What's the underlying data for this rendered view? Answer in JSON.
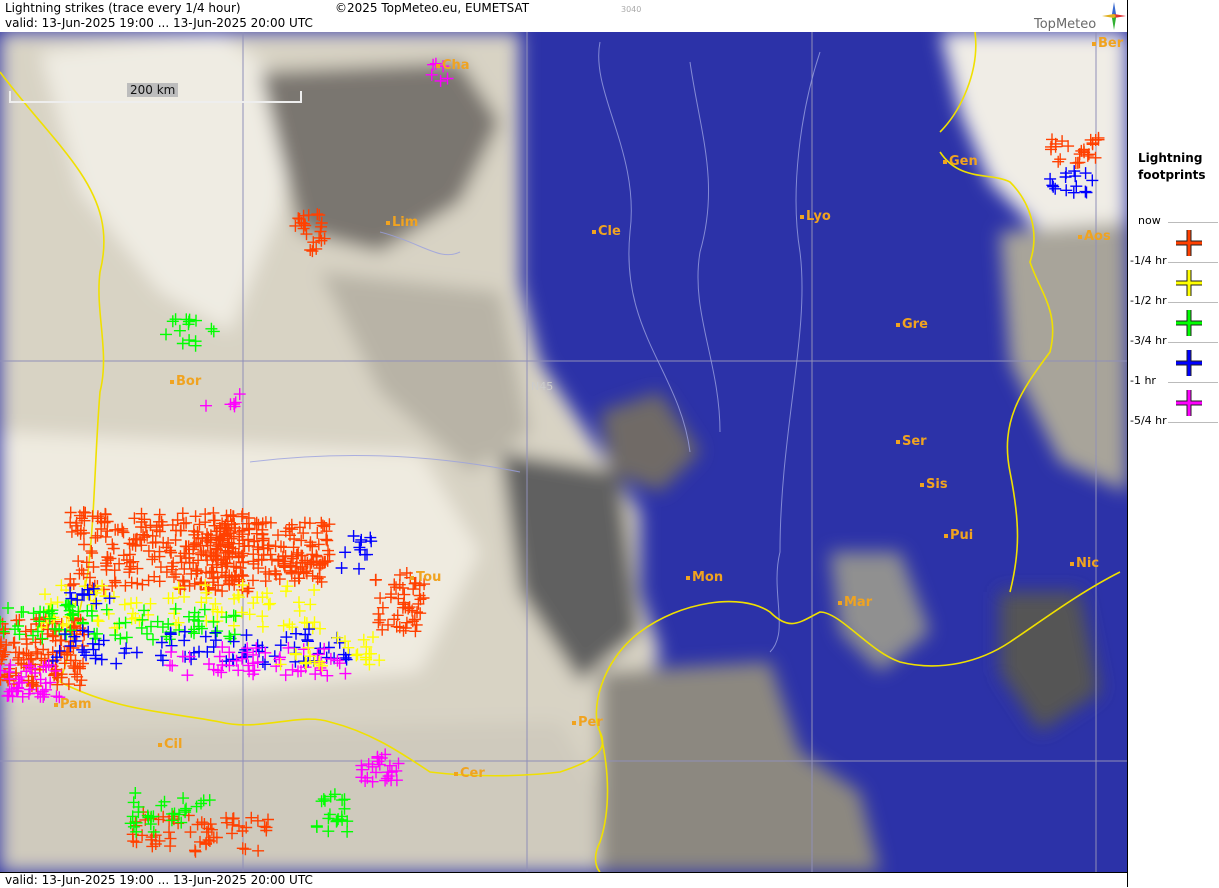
{
  "header": {
    "title": "Lightning strikes (trace every 1/4 hour)",
    "valid": "valid:  13-Jun-2025 19:00 ... 13-Jun-2025 20:00 UTC",
    "copyright": "©2025 TopMeteo.eu, EUMETSAT",
    "code": "3040"
  },
  "logo": {
    "text": "TopMeteo"
  },
  "footer": {
    "valid": "valid:  13-Jun-2025 19:00 ... 13-Jun-2025 20:00 UTC"
  },
  "map": {
    "scale_label": "200 km",
    "grid_label": "N45",
    "colors": {
      "sea": "#2c32a8",
      "cloud": "#e8e3d6",
      "coast": "#f0e000",
      "city": "#f0a320"
    },
    "cities": [
      "Cha",
      "Ber",
      "Gen",
      "Lim",
      "Cle",
      "Lyo",
      "Aos",
      "Gre",
      "Bor",
      "Ser",
      "Sis",
      "Pui",
      "Tou",
      "Mon",
      "Mar",
      "Nic",
      "Pam",
      "Cil",
      "Per",
      "Cer"
    ]
  },
  "legend": {
    "title_line1": "Lightning",
    "title_line2": "footprints",
    "items": [
      {
        "label": "now",
        "color": "#ff4000"
      },
      {
        "label": "-1/4 hr",
        "color": "#ffff00"
      },
      {
        "label": "-1/2 hr",
        "color": "#00ff00"
      },
      {
        "label": "-3/4 hr",
        "color": "#0000ff"
      },
      {
        "label": "-1 hr",
        "color": "#ff00ff"
      },
      {
        "label": "-5/4 hr",
        "color": ""
      }
    ]
  }
}
